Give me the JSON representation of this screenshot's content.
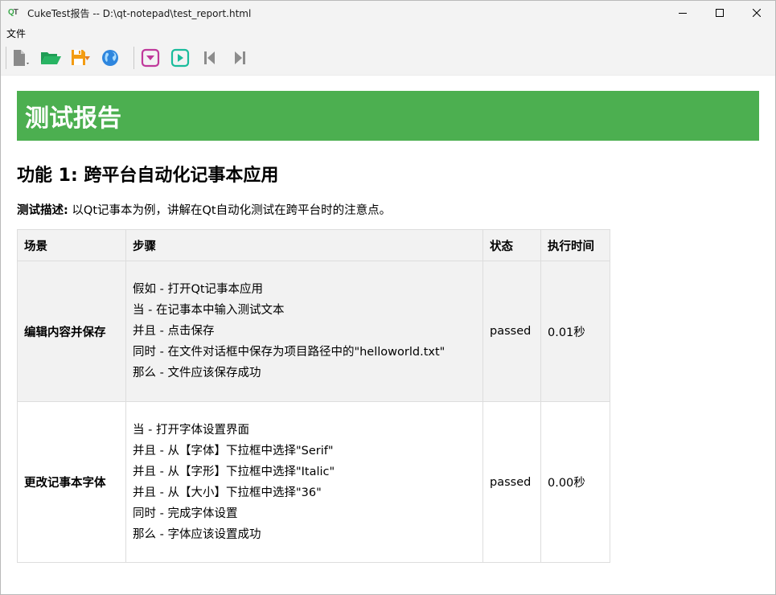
{
  "window": {
    "title": "CukeTest报告 -- D:\\qt-notepad\\test_report.html",
    "app_icon": {
      "q": "Q",
      "t": "T"
    }
  },
  "menubar": {
    "items": [
      "文件"
    ]
  },
  "toolbar": {
    "icons": [
      "new-file-icon",
      "open-folder-icon",
      "save-icon",
      "globe-icon",
      "record-icon",
      "play-icon",
      "skip-previous-icon",
      "skip-next-icon"
    ]
  },
  "report": {
    "header": "测试报告",
    "feature_title": "功能 1: 跨平台自动化记事本应用",
    "description_label": "测试描述:",
    "description_text": " 以Qt记事本为例，讲解在Qt自动化测试在跨平台时的注意点。",
    "table": {
      "headers": [
        "场景",
        "步骤",
        "状态",
        "执行时间"
      ],
      "rows": [
        {
          "scenario": "编辑内容并保存",
          "steps": [
            "假如 - 打开Qt记事本应用",
            "当 - 在记事本中输入测试文本",
            "并且 - 点击保存",
            "同时 - 在文件对话框中保存为项目路径中的\"helloworld.txt\"",
            "那么 - 文件应该保存成功"
          ],
          "status": "passed",
          "time": "0.01秒"
        },
        {
          "scenario": "更改记事本字体",
          "steps": [
            "当 - 打开字体设置界面",
            "并且 - 从【字体】下拉框中选择\"Serif\"",
            "并且 - 从【字形】下拉框中选择\"Italic\"",
            "并且 - 从【大小】下拉框中选择\"36\"",
            "同时 - 完成字体设置",
            "那么 - 字体应该设置成功"
          ],
          "status": "passed",
          "time": "0.00秒"
        }
      ]
    }
  },
  "colors": {
    "header_green": "#4caf50",
    "row_alt": "#f2f2f2"
  }
}
